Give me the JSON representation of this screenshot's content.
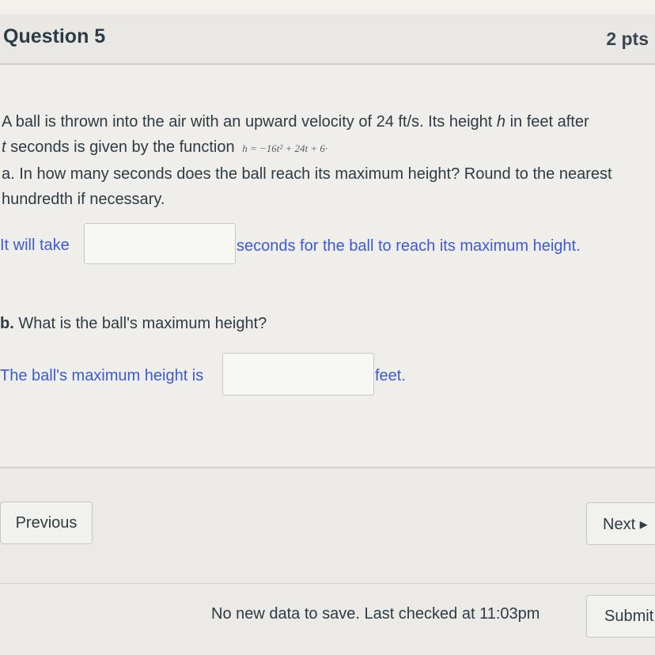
{
  "question": {
    "title": "Question 5",
    "points": "2 pts",
    "prompt_line1_a": "A ball is thrown into the air with an upward velocity of 24 ft/s. Its height ",
    "prompt_line1_var": "h",
    "prompt_line1_b": " in feet after",
    "prompt_line2_var": "t",
    "prompt_line2_a": " seconds is given by the function ",
    "formula": "h = −16t² + 24t + 6·",
    "part_a_line1": "a. In how many seconds does the ball reach its maximum height? Round to the nearest",
    "part_a_line2": "hundredth if necessary.",
    "answer_a_prefix": "It will take",
    "answer_a_value": "",
    "answer_a_suffix": "seconds for the ball to reach its maximum height.",
    "part_b_label": "b.",
    "part_b_text": " What is the ball's maximum height?",
    "answer_b_prefix": "The ball's maximum height is",
    "answer_b_value": "",
    "answer_b_suffix": "feet."
  },
  "navigation": {
    "previous_label": "Previous",
    "next_label": "Next ▸"
  },
  "footer": {
    "save_status": "No new data to save. Last checked at 11:03pm",
    "submit_label": "Submit"
  },
  "colors": {
    "accent_blue": "#3b5bd6",
    "text": "#2d3b45"
  }
}
